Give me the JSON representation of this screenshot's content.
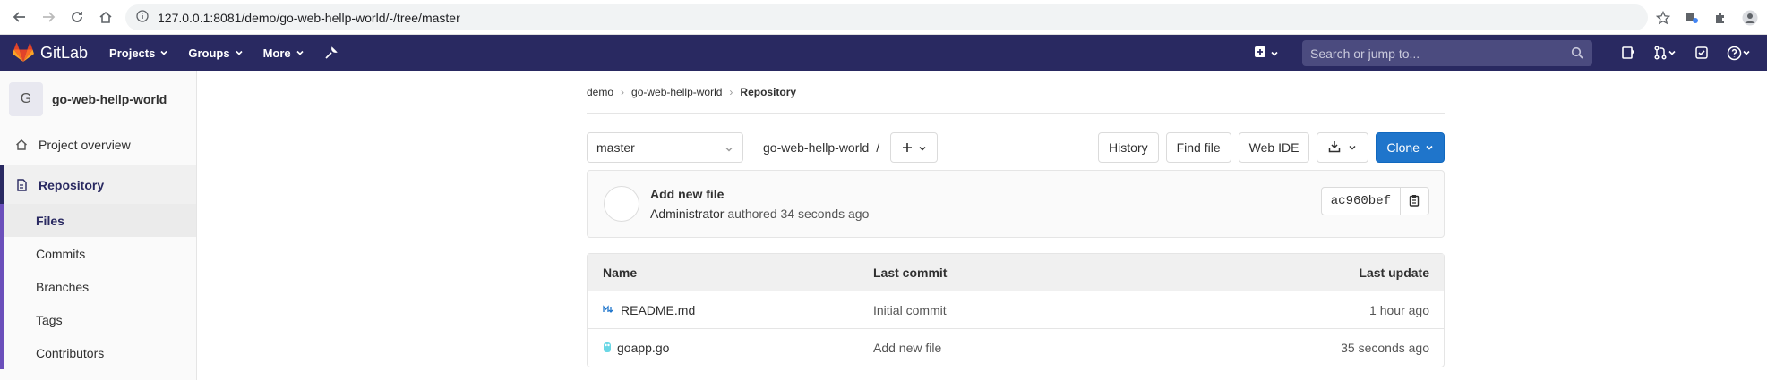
{
  "browser": {
    "url": "127.0.0.1:8081/demo/go-web-hellp-world/-/tree/master"
  },
  "header": {
    "logo_text": "GitLab",
    "menu": [
      {
        "label": "Projects"
      },
      {
        "label": "Groups"
      },
      {
        "label": "More"
      }
    ],
    "search_placeholder": "Search or jump to..."
  },
  "sidebar": {
    "project_initial": "G",
    "project_name": "go-web-hellp-world",
    "items": {
      "overview": "Project overview",
      "repository": "Repository"
    },
    "repo_sub": {
      "files": "Files",
      "commits": "Commits",
      "branches": "Branches",
      "tags": "Tags",
      "contributors": "Contributors"
    }
  },
  "breadcrumb": {
    "group": "demo",
    "project": "go-web-hellp-world",
    "current": "Repository"
  },
  "toolbar": {
    "branch": "master",
    "path_name": "go-web-hellp-world",
    "path_sep": "/",
    "history": "History",
    "find_file": "Find file",
    "web_ide": "Web IDE",
    "clone": "Clone"
  },
  "last_commit": {
    "title": "Add new file",
    "author": "Administrator",
    "meta": "authored 34 seconds ago",
    "sha": "ac960bef"
  },
  "file_table": {
    "headers": {
      "name": "Name",
      "last_commit": "Last commit",
      "last_update": "Last update"
    },
    "rows": [
      {
        "name": "README.md",
        "commit": "Initial commit",
        "update": "1 hour ago"
      },
      {
        "name": "goapp.go",
        "commit": "Add new file",
        "update": "35 seconds ago"
      }
    ]
  }
}
